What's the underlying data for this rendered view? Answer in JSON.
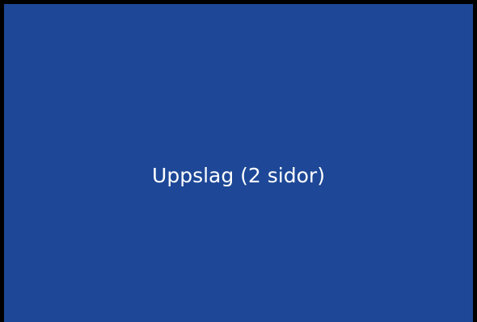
{
  "panel": {
    "label": "Uppslag (2 sidor)",
    "background_color": "#1e4897",
    "border_color": "#000000",
    "text_color": "#ffffff"
  }
}
